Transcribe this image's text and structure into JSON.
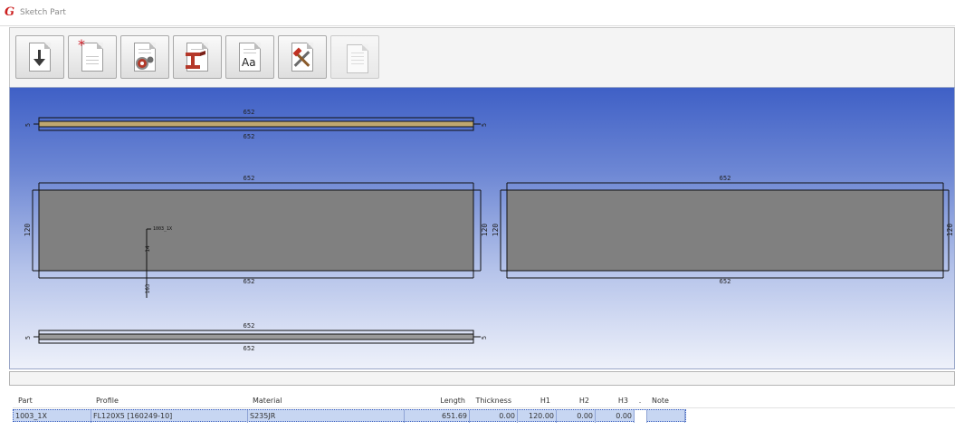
{
  "window": {
    "title": "Sketch Part",
    "logo_glyph": "G"
  },
  "toolbar": {
    "buttons": [
      {
        "name": "import-button",
        "icon": "download-arrow-document-icon"
      },
      {
        "name": "new-button",
        "icon": "new-document-star-icon"
      },
      {
        "name": "settings-button",
        "icon": "gear-document-icon"
      },
      {
        "name": "profile-button",
        "icon": "beam-profile-document-icon"
      },
      {
        "name": "text-button",
        "icon": "font-aa-document-icon",
        "text": "Aa"
      },
      {
        "name": "tools-button",
        "icon": "hammer-wrench-icon"
      },
      {
        "name": "pages-button",
        "icon": "stacked-documents-icon",
        "disabled": true
      }
    ]
  },
  "drawing": {
    "views": [
      {
        "name": "top-view",
        "top_dim": "652",
        "bottom_dim": "652",
        "left_dim": "5",
        "right_dim": "5"
      },
      {
        "name": "front-view",
        "top_dim": "652",
        "bottom_dim": "652",
        "left_dim": "120",
        "right_dim": "120",
        "mark_label": "1003_1X",
        "mark_dim_1": "14",
        "mark_dim_2": "163"
      },
      {
        "name": "side-view",
        "top_dim": "652",
        "bottom_dim": "652",
        "left_dim": "120",
        "right_dim": "120"
      },
      {
        "name": "bottom-view",
        "top_dim": "652",
        "bottom_dim": "652",
        "left_dim": "5",
        "right_dim": "5"
      }
    ]
  },
  "table": {
    "headers": {
      "part": "Part",
      "profile": "Profile",
      "material": "Material",
      "length": "Length",
      "thickness": "Thickness",
      "h1": "H1",
      "h2": "H2",
      "h3": "H3",
      "dot": ".",
      "note": "Note"
    },
    "rows": [
      {
        "part": "1003_1X",
        "profile": "FL120X5 [160249-10]",
        "material": "S235JR",
        "length": "651.69",
        "thickness": "0.00",
        "h1": "120.00",
        "h2": "0.00",
        "h3": "0.00",
        "checked": false,
        "note": ""
      }
    ]
  }
}
